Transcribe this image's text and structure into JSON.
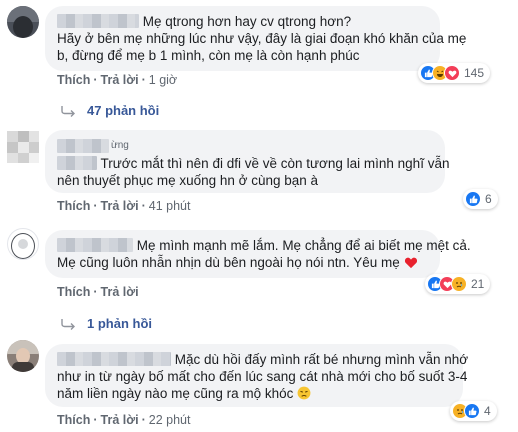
{
  "colors": {
    "like": "#1877f2",
    "love": "#f33e58",
    "haha": "#f7b125",
    "link": "#385898",
    "meta": "#606770",
    "bubble": "#f2f3f5"
  },
  "actions_labels": {
    "like": "Thích",
    "reply": "Trả lời"
  },
  "comments": [
    {
      "lines": [
        "Mẹ qtrong hơn hay cv qtrong hơn?",
        "Hãy ở bên mẹ những lúc như vậy, đây là giai đoạn khó khăn của mẹ",
        "b, đừng để mẹ b 1 mình, còn mẹ là còn hạnh phúc"
      ],
      "time": "1 giờ",
      "reactions": [
        "like-icon",
        "haha-icon",
        "love-icon"
      ],
      "reaction_count": "145",
      "replies_label": "47 phản hồi"
    },
    {
      "name_tail": "ừng",
      "lines": [
        "Trước mắt thì nên đi dfi về về còn tương lai mình nghĩ vẫn",
        "nên thuyết phục mẹ xuống hn ở cùng bạn à"
      ],
      "time": "41 phút",
      "reactions": [
        "like-icon"
      ],
      "reaction_count": "6"
    },
    {
      "lines": [
        "Mẹ mình mạnh mẽ lắm. Mẹ chẳng để ai biết mẹ mệt cả.",
        "Mẹ cũng luôn nhẫn nhịn dù bên ngoài họ nói ntn. Yêu mẹ"
      ],
      "line_end_emoji": "heart-emoji",
      "time": "Trả lời",
      "reactions": [
        "like-icon",
        "love-icon",
        "sad-icon"
      ],
      "reaction_count": "21",
      "replies_label": "1 phản hồi"
    },
    {
      "lines": [
        "Mặc dù hồi đấy mình rất bé nhưng mình vẫn nhớ",
        "như in từ ngày bố mất cho đến lúc sang cát nhà mới cho bố suốt 3-4",
        "năm liền ngày nào mẹ cũng ra mộ khóc"
      ],
      "line_end_emoji": "disappointed-emoji",
      "time": "22 phút",
      "reactions": [
        "sad-icon",
        "like-icon"
      ],
      "reaction_count": "4"
    }
  ]
}
